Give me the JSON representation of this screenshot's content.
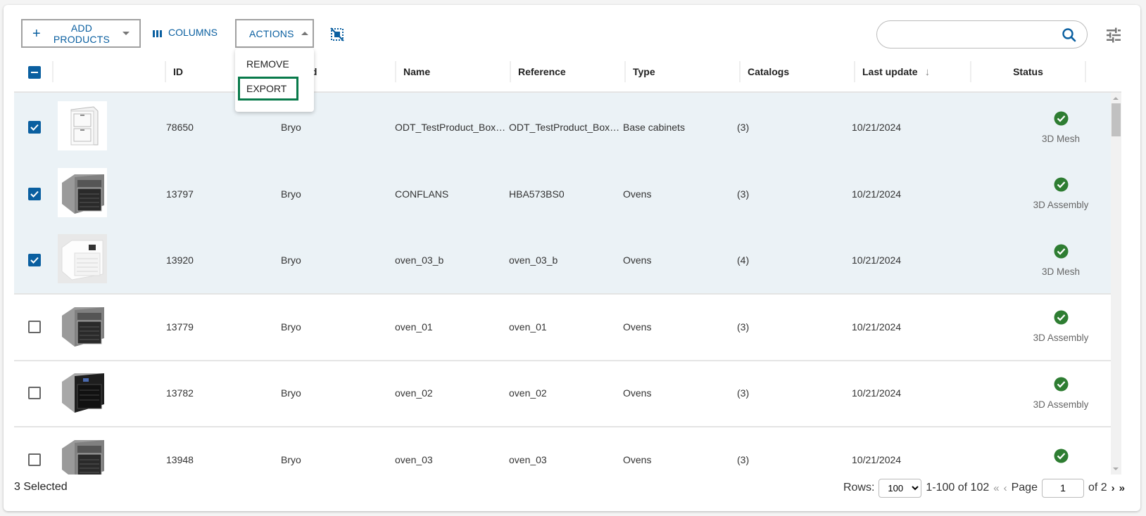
{
  "toolbar": {
    "add_products_label": "ADD PRODUCTS",
    "columns_label": "COLUMNS",
    "actions_label": "ACTIONS",
    "search_value": "",
    "search_placeholder": ""
  },
  "actions_menu": {
    "open": true,
    "items": [
      {
        "label": "REMOVE",
        "highlighted": false
      },
      {
        "label": "EXPORT",
        "highlighted": true
      }
    ]
  },
  "table": {
    "select_all_state": "indeterminate",
    "columns": [
      {
        "key": "select",
        "label": ""
      },
      {
        "key": "image",
        "label": ""
      },
      {
        "key": "id",
        "label": "ID"
      },
      {
        "key": "brand",
        "label": "Brand"
      },
      {
        "key": "name",
        "label": "Name"
      },
      {
        "key": "reference",
        "label": "Reference"
      },
      {
        "key": "type",
        "label": "Type"
      },
      {
        "key": "catalogs",
        "label": "Catalogs"
      },
      {
        "key": "last_update",
        "label": "Last update",
        "sort": "descending"
      },
      {
        "key": "status",
        "label": "Status"
      }
    ],
    "rows": [
      {
        "selected": true,
        "image": "base-cabinet-thumbnail",
        "id": "78650",
        "brand": "Bryo",
        "name": "ODT_TestProduct_Box…",
        "reference": "ODT_TestProduct_Box…",
        "type": "Base cabinets",
        "catalogs": "(3)",
        "last_update": "10/21/2024",
        "status": "3D Mesh",
        "status_ok": true
      },
      {
        "selected": true,
        "image": "oven-steel-thumbnail",
        "id": "13797",
        "brand": "Bryo",
        "name": "CONFLANS",
        "reference": "HBA573BS0",
        "type": "Ovens",
        "catalogs": "(3)",
        "last_update": "10/21/2024",
        "status": "3D Assembly",
        "status_ok": true
      },
      {
        "selected": true,
        "image": "oven-white-thumbnail",
        "id": "13920",
        "brand": "Bryo",
        "name": "oven_03_b",
        "reference": "oven_03_b",
        "type": "Ovens",
        "catalogs": "(4)",
        "last_update": "10/21/2024",
        "status": "3D Mesh",
        "status_ok": true
      },
      {
        "selected": false,
        "image": "oven-steel-thumbnail",
        "id": "13779",
        "brand": "Bryo",
        "name": "oven_01",
        "reference": "oven_01",
        "type": "Ovens",
        "catalogs": "(3)",
        "last_update": "10/21/2024",
        "status": "3D Assembly",
        "status_ok": true
      },
      {
        "selected": false,
        "image": "oven-black-thumbnail",
        "id": "13782",
        "brand": "Bryo",
        "name": "oven_02",
        "reference": "oven_02",
        "type": "Ovens",
        "catalogs": "(3)",
        "last_update": "10/21/2024",
        "status": "3D Assembly",
        "status_ok": true
      },
      {
        "selected": false,
        "image": "oven-steel-thumbnail",
        "id": "13948",
        "brand": "Bryo",
        "name": "oven_03",
        "reference": "oven_03",
        "type": "Ovens",
        "catalogs": "(3)",
        "last_update": "10/21/2024",
        "status": "",
        "status_ok": true
      }
    ]
  },
  "footer": {
    "selected_text": "3 Selected",
    "rows_label": "Rows:",
    "rows_per_page": "100",
    "range_text": "1-100 of 102",
    "page_label": "Page",
    "page_value": "1",
    "of_pages": "of 2"
  },
  "colors": {
    "accent": "#0a5fa0",
    "selected_row": "#ebf2f6",
    "status_ok": "#2e7d32",
    "menu_highlight": "#087a4a"
  }
}
